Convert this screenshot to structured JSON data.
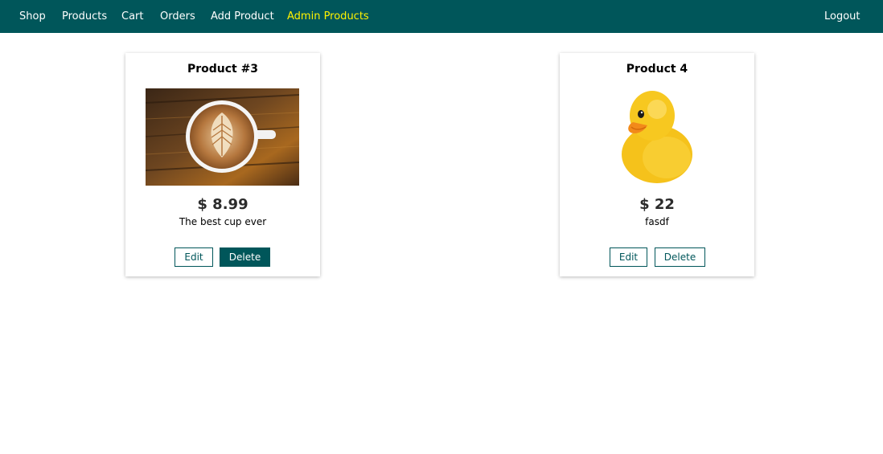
{
  "nav": {
    "shop": "Shop",
    "products": "Products",
    "cart": "Cart",
    "orders": "Orders",
    "add_product": "Add Product",
    "admin_products": "Admin Products",
    "logout": "Logout"
  },
  "colors": {
    "primary": "#00565a",
    "active_nav": "#fff200"
  },
  "products": [
    {
      "title": "Product #3",
      "image": "coffee-cup-image",
      "price": "$ 8.99",
      "description": "The best cup ever",
      "edit_label": "Edit",
      "delete_label": "Delete"
    },
    {
      "title": "Product 4",
      "image": "rubber-duck-image",
      "price": "$ 22",
      "description": "fasdf",
      "edit_label": "Edit",
      "delete_label": "Delete"
    }
  ]
}
